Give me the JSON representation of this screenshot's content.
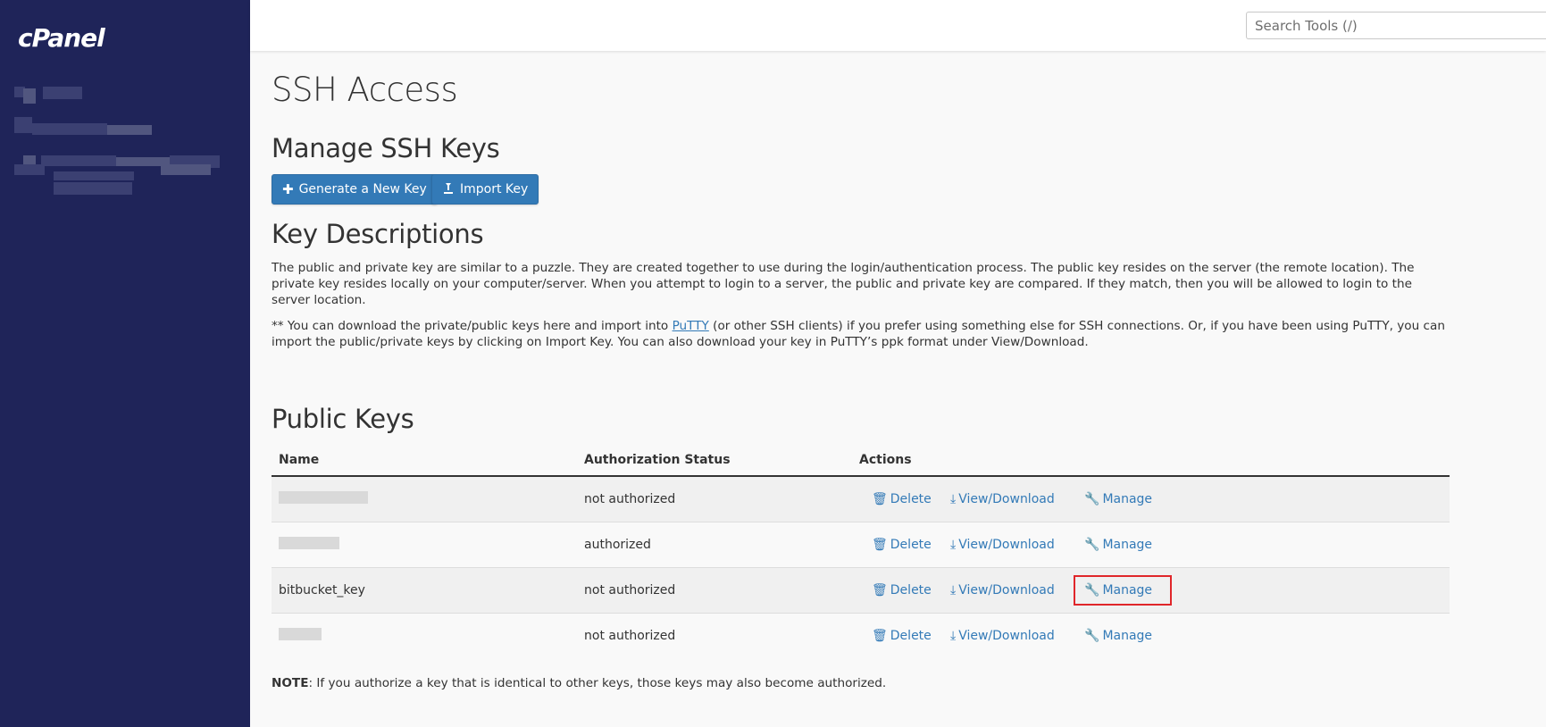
{
  "sidebar": {
    "logo": "cPanel"
  },
  "topbar": {
    "search_placeholder": "Search Tools (/)"
  },
  "page": {
    "title": "SSH Access",
    "manage_heading": "Manage SSH Keys",
    "generate_label": "Generate a New Key",
    "import_label": "Import Key",
    "descriptions_heading": "Key Descriptions",
    "desc_para1": "The public and private key are similar to a puzzle. They are created together to use during the login/authentication process. The public key resides on the server (the remote location). The private key resides locally on your computer/server. When you attempt to login to a server, the public and private key are compared. If they match, then you will be allowed to login to the server location.",
    "desc_para2_before": "** You can download the private/public keys here and import into ",
    "desc_para2_link": "PuTTY",
    "desc_para2_after": " (or other SSH clients) if you prefer using something else for SSH connections. Or, if you have been using PuTTY, you can import the public/private keys by clicking on Import Key. You can also download your key in PuTTY’s ppk format under View/Download.",
    "public_keys_heading": "Public Keys",
    "note_label": "NOTE",
    "note_text": ": If you authorize a key that is identical to other keys, those keys may also become authorized."
  },
  "table": {
    "headers": {
      "name": "Name",
      "status": "Authorization Status",
      "actions": "Actions"
    },
    "action_labels": {
      "delete": "Delete",
      "view": "View/Download",
      "manage": "Manage"
    },
    "rows": [
      {
        "name": "",
        "status": "not authorized"
      },
      {
        "name": "",
        "status": "authorized"
      },
      {
        "name": "bitbucket_key",
        "status": "not authorized"
      },
      {
        "name": "",
        "status": "not authorized"
      }
    ]
  },
  "icons": {
    "plus": "plus-icon",
    "import": "import-icon",
    "delete": "trash-icon",
    "view": "download-icon",
    "manage": "wrench-icon"
  },
  "colors": {
    "sidebar_bg": "#1f2459",
    "primary": "#337ab7",
    "highlight_outline": "#e0262a"
  }
}
